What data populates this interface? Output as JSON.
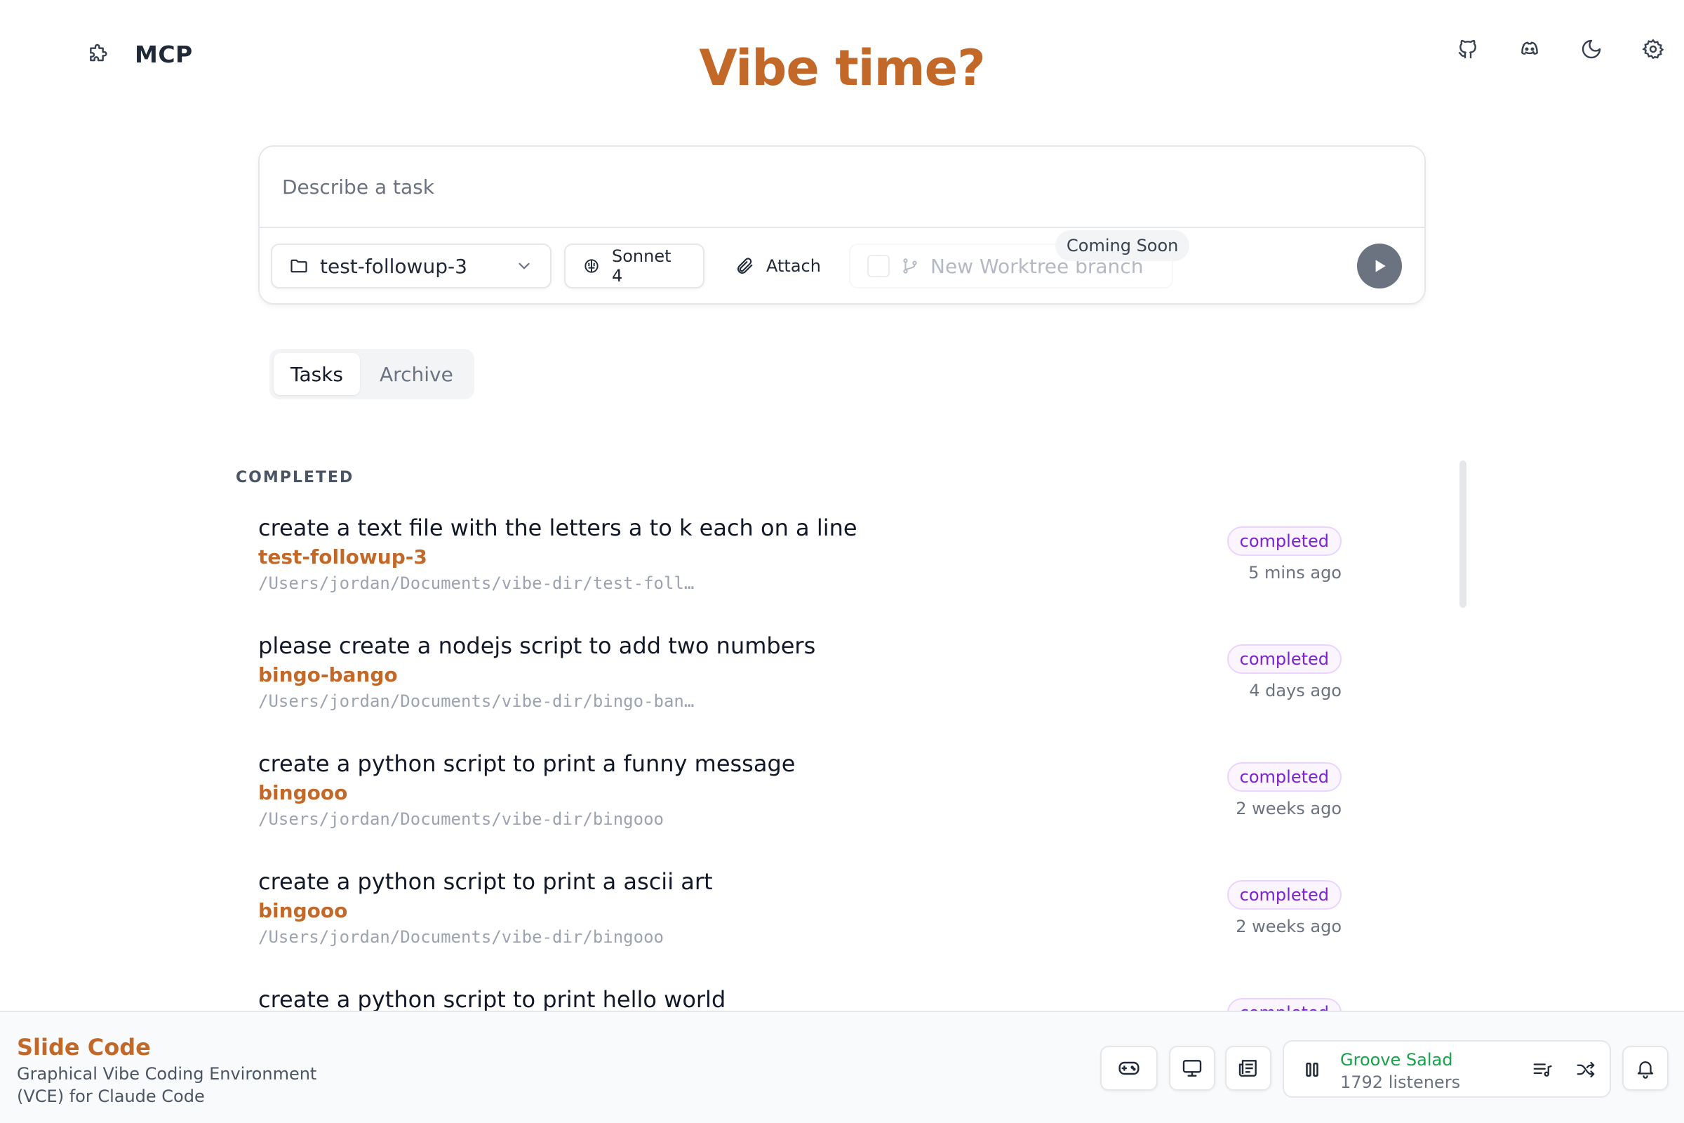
{
  "header": {
    "mcp_label": "MCP",
    "title": "Vibe time?",
    "icons": [
      "github-icon",
      "discord-icon",
      "moon-icon",
      "settings-icon"
    ]
  },
  "task_input": {
    "placeholder": "Describe a task",
    "folder": "test-followup-3",
    "model": "Sonnet 4",
    "attach": "Attach",
    "worktree_placeholder": "New Worktree branch",
    "coming_soon": "Coming Soon"
  },
  "tabs": [
    {
      "label": "Tasks",
      "active": true
    },
    {
      "label": "Archive",
      "active": false
    }
  ],
  "section_label": "COMPLETED",
  "tasks": [
    {
      "title": "create a text file with the letters a to k each on a line",
      "branch": "test-followup-3",
      "path": "/Users/jordan/Documents/vibe-dir/test-foll…",
      "status": "completed",
      "time": "5 mins ago"
    },
    {
      "title": "please create a nodejs script to add two numbers",
      "branch": "bingo-bango",
      "path": "/Users/jordan/Documents/vibe-dir/bingo-ban…",
      "status": "completed",
      "time": "4 days ago"
    },
    {
      "title": "create a python script to print a funny message",
      "branch": "bingooo",
      "path": "/Users/jordan/Documents/vibe-dir/bingooo",
      "status": "completed",
      "time": "2 weeks ago"
    },
    {
      "title": "create a python script to print a ascii art",
      "branch": "bingooo",
      "path": "/Users/jordan/Documents/vibe-dir/bingooo",
      "status": "completed",
      "time": "2 weeks ago"
    },
    {
      "title": "create a python script to print hello world",
      "branch": "",
      "path": "",
      "status": "completed",
      "time": ""
    }
  ],
  "footer": {
    "brand_name": "Slide Code",
    "brand_desc": "Graphical Vibe Coding Environment (VCE) for Claude Code",
    "station": "Groove Salad",
    "listeners": "1792 listeners"
  },
  "colors": {
    "accent": "#c2692a",
    "badge_text": "#7e22ce",
    "station": "#16a34a"
  }
}
